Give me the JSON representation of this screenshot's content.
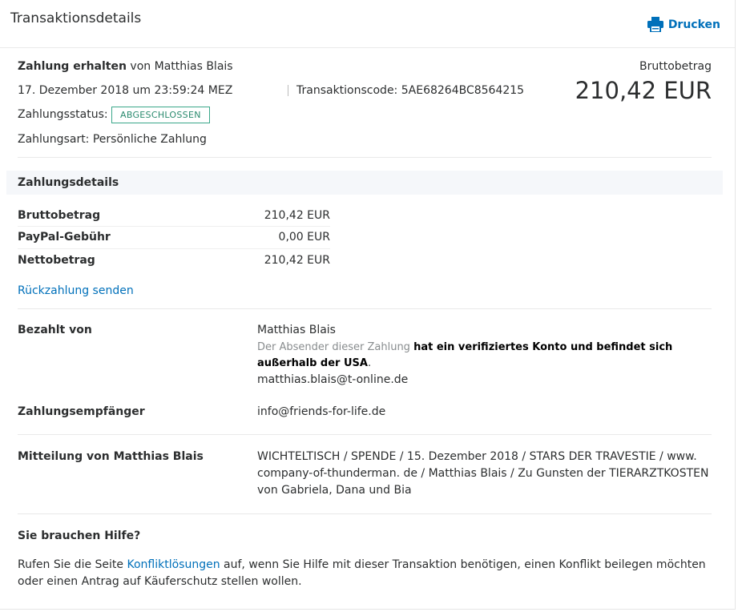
{
  "header": {
    "title": "Transaktionsdetails",
    "print_label": "Drucken"
  },
  "summary": {
    "type_label": "Zahlung erhalten",
    "from_prefix": "von",
    "from_name": "Matthias Blais",
    "date": "17. Dezember 2018 um 23:59:24 MEZ",
    "transaction_code_label": "Transaktionscode:",
    "transaction_code": "5AE68264BC8564215",
    "status_label": "Zahlungsstatus:",
    "status_value": "ABGESCHLOSSEN",
    "payment_type": "Zahlungsart: Persönliche Zahlung",
    "gross_label": "Bruttobetrag",
    "gross_amount": "210,42 EUR"
  },
  "details": {
    "section_title": "Zahlungsdetails",
    "rows": [
      {
        "label": "Bruttobetrag",
        "value": "210,42 EUR"
      },
      {
        "label": "PayPal-Gebühr",
        "value": "0,00 EUR"
      },
      {
        "label": "Nettobetrag",
        "value": "210,42 EUR"
      }
    ],
    "refund_link": "Rückzahlung senden"
  },
  "parties": {
    "paid_by_label": "Bezahlt von",
    "payer_name": "Matthias Blais",
    "verified_prefix": "Der Absender dieser Zahlung",
    "verified_bold": "hat ein verifiziertes Konto und befindet sich außerhalb der USA",
    "verified_suffix": ".",
    "payer_email": "matthias.blais@t-online.de",
    "recipient_label": "Zahlungsempfänger",
    "recipient_email": "info@friends-for-life.de"
  },
  "message": {
    "label": "Mitteilung von Matthias Blais",
    "text": "WICHTELTISCH / SPENDE / 15. Dezember 2018 / STARS DER TRAVESTIE / www. company-of-thunderman. de / Matthias Blais / Zu Gunsten der TIERARZTKOSTEN von Gabriela, Dana und Bia"
  },
  "help": {
    "title": "Sie brauchen Hilfe?",
    "text_before": "Rufen Sie die Seite",
    "link_label": "Konfliktlösungen",
    "text_after": "auf, wenn Sie Hilfe mit dieser Transaktion benötigen, einen Konflikt beilegen möchten oder einen Antrag auf Käuferschutz stellen wollen."
  },
  "colors": {
    "accent": "#0070ba",
    "status": "#3aa78a",
    "text": "#2c2e2f",
    "muted": "#888c8e"
  }
}
